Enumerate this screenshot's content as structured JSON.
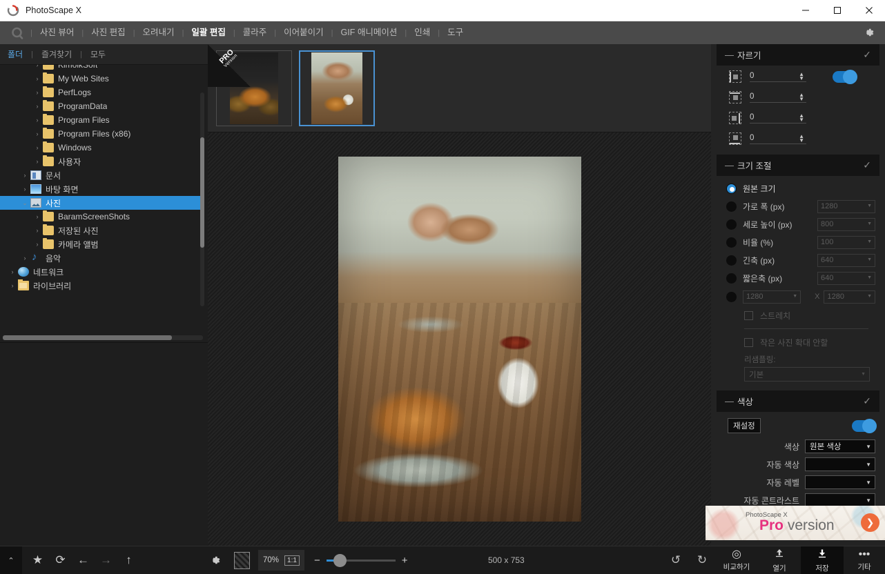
{
  "window": {
    "title": "PhotoScape X",
    "controls": {
      "minimize": "—",
      "maximize": "☐",
      "close": "✕"
    }
  },
  "menubar": {
    "items": [
      {
        "label": "사진 뷰어",
        "active": false
      },
      {
        "label": "사진 편집",
        "active": false
      },
      {
        "label": "오려내기",
        "active": false
      },
      {
        "label": "일괄 편집",
        "active": true
      },
      {
        "label": "콜라주",
        "active": false
      },
      {
        "label": "이어붙이기",
        "active": false
      },
      {
        "label": "GIF 애니메이션",
        "active": false
      },
      {
        "label": "인쇄",
        "active": false
      },
      {
        "label": "도구",
        "active": false
      }
    ],
    "separator": "|",
    "settings_icon": "gear-icon"
  },
  "left_panel": {
    "tabs": [
      {
        "label": "폴더",
        "active": true
      },
      {
        "label": "즐겨찾기",
        "active": false
      },
      {
        "label": "모두",
        "active": false
      }
    ],
    "tree": [
      {
        "label": "KimoikSoft",
        "indent": 2,
        "icon": "folder",
        "expander": "›",
        "selected": false,
        "clipped": true
      },
      {
        "label": "My Web Sites",
        "indent": 2,
        "icon": "folder",
        "expander": "›",
        "selected": false
      },
      {
        "label": "PerfLogs",
        "indent": 2,
        "icon": "folder",
        "expander": "›",
        "selected": false
      },
      {
        "label": "ProgramData",
        "indent": 2,
        "icon": "folder",
        "expander": "›",
        "selected": false
      },
      {
        "label": "Program Files",
        "indent": 2,
        "icon": "folder",
        "expander": "›",
        "selected": false
      },
      {
        "label": "Program Files (x86)",
        "indent": 2,
        "icon": "folder",
        "expander": "›",
        "selected": false
      },
      {
        "label": "Windows",
        "indent": 2,
        "icon": "folder",
        "expander": "›",
        "selected": false
      },
      {
        "label": "사용자",
        "indent": 2,
        "icon": "folder",
        "expander": "›",
        "selected": false
      },
      {
        "label": "문서",
        "indent": 1,
        "icon": "doc",
        "expander": "›",
        "selected": false
      },
      {
        "label": "바탕 화면",
        "indent": 1,
        "icon": "desktop",
        "expander": "›",
        "selected": false
      },
      {
        "label": "사진",
        "indent": 1,
        "icon": "photo",
        "expander": "⌄",
        "selected": true
      },
      {
        "label": "BaramScreenShots",
        "indent": 2,
        "icon": "folder",
        "expander": "›",
        "selected": false
      },
      {
        "label": "저장된 사진",
        "indent": 2,
        "icon": "folder",
        "expander": "›",
        "selected": false
      },
      {
        "label": "카메라 앨범",
        "indent": 2,
        "icon": "folder",
        "expander": "›",
        "selected": false
      },
      {
        "label": "음악",
        "indent": 1,
        "icon": "music",
        "expander": "›",
        "selected": false
      },
      {
        "label": "네트워크",
        "indent": 0,
        "icon": "net",
        "expander": "›",
        "selected": false
      },
      {
        "label": "라이브러리",
        "indent": 0,
        "icon": "lib",
        "expander": "›",
        "selected": false
      }
    ],
    "collapse_handle": "‹"
  },
  "thumbstrip": {
    "pro_badge": {
      "line1": "PRO",
      "line2": "Version"
    },
    "thumbnails": [
      {
        "name": "thumbnail-1",
        "selected": false
      },
      {
        "name": "thumbnail-2",
        "selected": true
      }
    ]
  },
  "right_panel": {
    "crop": {
      "title": "자르기",
      "minus": "—",
      "check": "✓",
      "toggle_on": true,
      "fields": [
        {
          "icon": "crop-left-icon",
          "value": "0"
        },
        {
          "icon": "crop-top-icon",
          "value": "0"
        },
        {
          "icon": "crop-right-icon",
          "value": "0"
        },
        {
          "icon": "crop-bottom-icon",
          "value": "0"
        }
      ]
    },
    "resize": {
      "title": "크기 조절",
      "minus": "—",
      "check": "✓",
      "options": [
        {
          "label": "원본 크기",
          "selected": true,
          "combo": null
        },
        {
          "label": "가로 폭 (px)",
          "selected": false,
          "combo": "1280"
        },
        {
          "label": "세로 높이 (px)",
          "selected": false,
          "combo": "800"
        },
        {
          "label": "비율 (%)",
          "selected": false,
          "combo": "100"
        },
        {
          "label": "긴축 (px)",
          "selected": false,
          "combo": "640"
        },
        {
          "label": "짧은축 (px)",
          "selected": false,
          "combo": "640"
        }
      ],
      "pair": {
        "selected": false,
        "width": "1280",
        "x": "X",
        "height": "1280"
      },
      "stretch": {
        "label": "스트레치",
        "checked": false
      },
      "no_enlarge": {
        "label": "작은 사진 확대 안할",
        "checked": false
      },
      "resampling_label": "리샘플링:",
      "resampling_value": "기본"
    },
    "color": {
      "title": "색상",
      "minus": "—",
      "check": "✓",
      "reset_label": "재설정",
      "toggle_on": true,
      "rows": [
        {
          "label": "색상",
          "value": "원본 색상",
          "highlight": true
        },
        {
          "label": "자동 색상",
          "value": "",
          "highlight": false
        },
        {
          "label": "자동 레벨",
          "value": "",
          "highlight": false
        },
        {
          "label": "자동 콘트라스트",
          "value": "",
          "highlight": false
        }
      ]
    },
    "pro_banner": {
      "brand": "PhotoScape X",
      "pro": "Pro",
      "version": " version",
      "arrow": "❯"
    }
  },
  "bottombar": {
    "caret": "⌃",
    "icons": [
      {
        "name": "favorite-star-icon",
        "glyph": "★",
        "dim": false
      },
      {
        "name": "refresh-icon",
        "glyph": "⟳",
        "dim": false
      },
      {
        "name": "back-arrow-icon",
        "glyph": "←",
        "dim": false
      },
      {
        "name": "forward-arrow-icon",
        "glyph": "→",
        "dim": true
      },
      {
        "name": "up-arrow-icon",
        "glyph": "↑",
        "dim": false
      }
    ],
    "settings_icon": "gear-icon",
    "checker_icon": "checker-background-icon",
    "zoom_percent": "70%",
    "one_to_one": "1:1",
    "zoom_minus": "−",
    "zoom_plus": "+",
    "dimensions": "500 x 753",
    "rotate_ccw": "↺",
    "rotate_cw": "↻",
    "actions": [
      {
        "label": "비교하기",
        "icon": "compare-icon",
        "selected": false
      },
      {
        "label": "열기",
        "icon": "open-upload-icon",
        "selected": false
      },
      {
        "label": "저장",
        "icon": "save-download-icon",
        "selected": true
      },
      {
        "label": "기타",
        "icon": "more-dots-icon",
        "selected": false
      }
    ]
  },
  "colors": {
    "accent": "#2d8fd8",
    "selected_row": "#2c8fd8",
    "panel_bg": "#232323",
    "canvas_bg": "#1b1b1b",
    "pro_pink": "#e6317f",
    "pro_orange": "#ee6b3b"
  }
}
